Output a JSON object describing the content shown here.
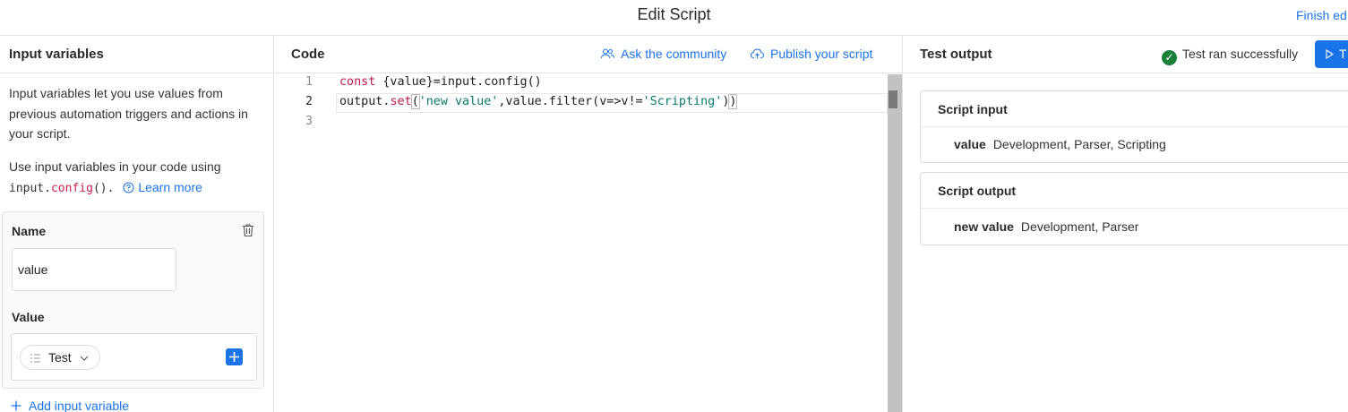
{
  "header": {
    "title": "Edit Script",
    "finish_label": "Finish ed"
  },
  "input_panel": {
    "title": "Input variables",
    "description": "Input variables let you use values from previous automation triggers and actions in your script.",
    "usage_prefix": "Use input variables in your code using",
    "usage_code_obj": "input.",
    "usage_code_fn": "config",
    "usage_code_suffix": "().",
    "learn_more": "Learn more",
    "variable": {
      "name_label": "Name",
      "name_value": "value",
      "value_label": "Value",
      "value_pill": "Test"
    },
    "add_variable": "Add input variable"
  },
  "code_panel": {
    "title": "Code",
    "ask_community": "Ask the community",
    "publish": "Publish your script",
    "lines": [
      {
        "number": "1"
      },
      {
        "number": "2"
      },
      {
        "number": "3"
      }
    ],
    "tokens": {
      "l1_kw": "const",
      "l1_rest": " {value}=input.config()",
      "l2_obj": "output.",
      "l2_fn": "set",
      "l2_open": "(",
      "l2_str1": "'new value'",
      "l2_mid": ",value.filter(v=>v!=",
      "l2_str2": "'Scripting'",
      "l2_close1": ")",
      "l2_close2": ")"
    }
  },
  "output_panel": {
    "title": "Test output",
    "status": "Test ran successfully",
    "test_button": "T",
    "script_input": {
      "title": "Script input",
      "key": "value",
      "val": "Development, Parser, Scripting"
    },
    "script_output": {
      "title": "Script output",
      "key": "new value",
      "val": "Development, Parser"
    }
  },
  "colors": {
    "accent": "#1b73e8",
    "success": "#188038",
    "keyword": "#c01b4a",
    "string": "#0b7a6b"
  }
}
